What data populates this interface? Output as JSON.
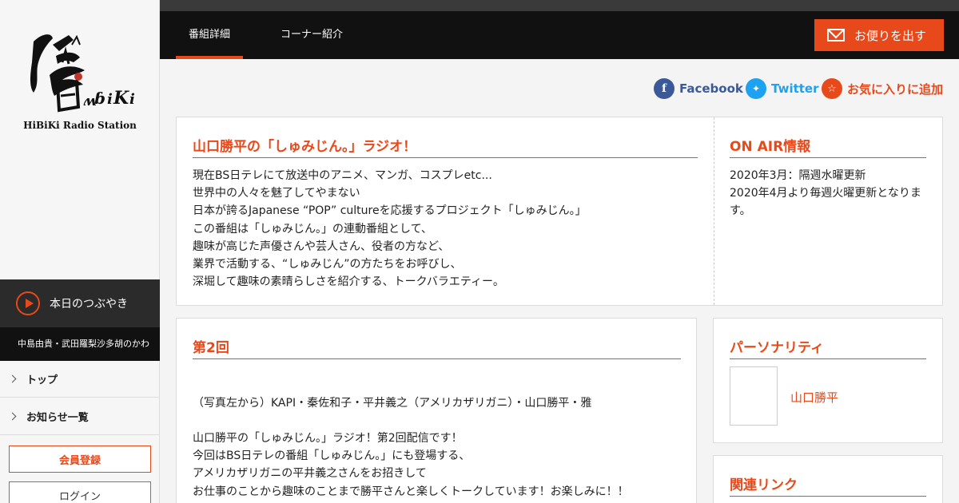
{
  "brand": {
    "logo_text": "HiBiKi Radio Station",
    "accent": "#e8491a"
  },
  "sidebar": {
    "tweet_label": "本日のつぶやき",
    "ticker": "中島由貴・武田羅梨沙多胡のかわ",
    "nav": [
      {
        "label": "トップ"
      },
      {
        "label": "お知らせ一覧"
      }
    ],
    "register_label": "会員登録",
    "login_label": "ログイン"
  },
  "header": {
    "tabs": [
      {
        "label": "番組詳細",
        "active": true
      },
      {
        "label": "コーナー紹介",
        "active": false
      }
    ],
    "letter_button": "お便りを出す"
  },
  "share": {
    "facebook": "Facebook",
    "twitter": "Twitter",
    "favorite": "お気に入りに追加",
    "colors": {
      "facebook": "#3b5998",
      "twitter": "#1da1f2",
      "favorite": "#e8491a"
    }
  },
  "program": {
    "title": "山口勝平の「しゅみじん。」ラジオ！",
    "lines": [
      "現在BS日テレにて放送中のアニメ、マンガ、コスプレetc...",
      "世界中の人々を魅了してやまない",
      "日本が誇るJapanese “POP” cultureを応援するプロジェクト「しゅみじん。」",
      "この番組は「しゅみじん。」の連動番組として、",
      "趣味が高じた声優さんや芸人さん、役者の方など、",
      "業界で活動する、“しゅみじん”の方たちをお呼びし、",
      "深堀して趣味の素晴らしさを紹介する、トークバラエティー。"
    ]
  },
  "onair": {
    "title": "ON AIR情報",
    "lines": [
      "2020年3月：隔週水曜更新",
      "2020年4月より毎週火曜更新となりま",
      "す。"
    ]
  },
  "episode": {
    "title": "第2回",
    "caption": "（写真左から）KAPI・秦佐和子・平井義之（アメリカザリガニ）・山口勝平・雅",
    "lines": [
      "山口勝平の「しゅみじん。」ラジオ！第2回配信です！",
      "今回はBS日テレの番組「しゅみじん。」にも登場する、",
      "アメリカザリガニの平井義之さんをお招きして",
      "お仕事のことから趣味のことまで勝平さんと楽しくトークしています！お楽しみに！！"
    ]
  },
  "personality": {
    "title": "パーソナリティ",
    "name": "山口勝平"
  },
  "related": {
    "title": "関連リンク"
  }
}
